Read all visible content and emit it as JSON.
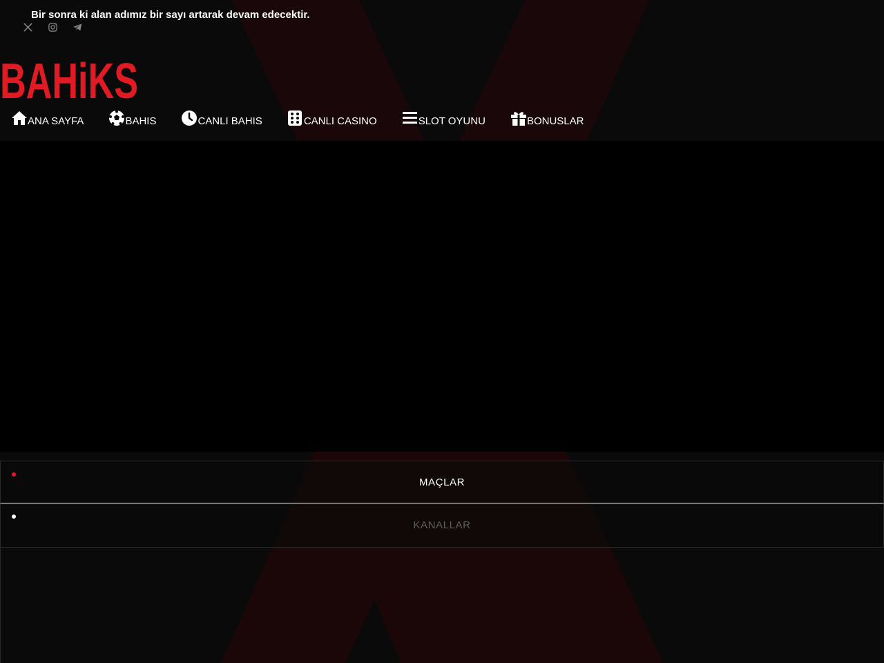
{
  "topbar": {
    "announcement": "Bir sonra ki alan adımız bir sayı artarak devam edecektir."
  },
  "social": [
    {
      "icon": "x-twitter-icon"
    },
    {
      "icon": "instagram-icon"
    },
    {
      "icon": "telegram-icon"
    }
  ],
  "logo": {
    "text": "BAHiKS",
    "color": "#e01b24"
  },
  "nav": [
    {
      "label": "ANA SAYFA",
      "icon": "home-icon"
    },
    {
      "label": "BAHIS",
      "icon": "soccer-ball-icon"
    },
    {
      "label": "CANLI BAHIS",
      "icon": "clock-icon"
    },
    {
      "label": "CANLI CASINO",
      "icon": "dice-icon"
    },
    {
      "label": "SLOT OYUNU",
      "icon": "bars-icon"
    },
    {
      "label": "BONUSLAR",
      "icon": "gift-icon"
    }
  ],
  "tabs": [
    {
      "label": "MAÇLAR",
      "active": true,
      "dot_color": "#e01b24"
    },
    {
      "label": "KANALLAR",
      "active": false,
      "dot_color": "#ffffff"
    }
  ],
  "colors": {
    "background": "#0a0a0a",
    "accent": "#e01b24",
    "stripe": "#1e0809"
  }
}
